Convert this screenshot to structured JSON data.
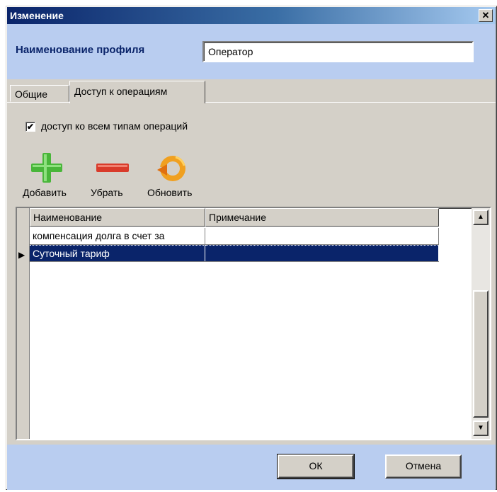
{
  "window": {
    "title": "Изменение",
    "close_glyph": "✕"
  },
  "profile": {
    "label": "Наименование профиля",
    "value": "Оператор"
  },
  "tabs": [
    {
      "label": "Общие",
      "active": false
    },
    {
      "label": "Доступ к операциям",
      "active": true
    }
  ],
  "access": {
    "all_types_label": "доступ ко всем типам операций",
    "all_types_checked": true,
    "check_glyph": "✔"
  },
  "toolbar": [
    {
      "label": "Добавить",
      "icon": "plus-icon",
      "color": "#49b63a"
    },
    {
      "label": "Убрать",
      "icon": "minus-icon",
      "color": "#d93b2b"
    },
    {
      "label": "Обновить",
      "icon": "refresh-icon",
      "color": "#f0a020"
    }
  ],
  "grid": {
    "columns": [
      "Наименование",
      "Примечание"
    ],
    "rows": [
      {
        "name": "компенсация долга в счет за",
        "note": "",
        "selected": false
      },
      {
        "name": "Суточный тариф",
        "note": "",
        "selected": true
      }
    ],
    "row_pointer": "▶",
    "scroll_up": "▲",
    "scroll_down": "▼"
  },
  "buttons": {
    "ok": "ОК",
    "cancel": "Отмена"
  },
  "colors": {
    "accent": "#0a246a",
    "band": "#b9cdf0",
    "face": "#d4d0c8"
  }
}
